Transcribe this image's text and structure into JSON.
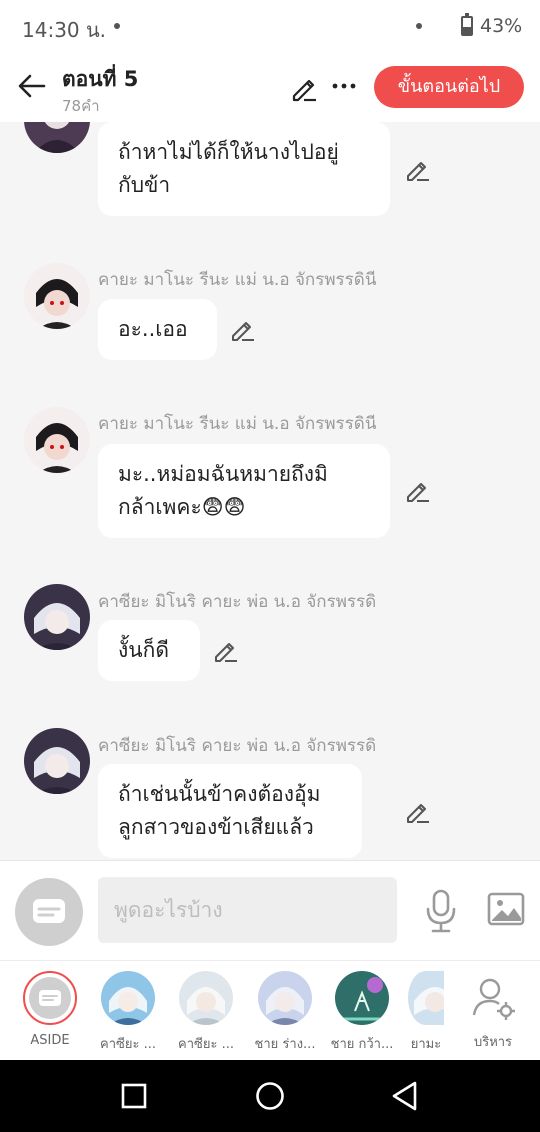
{
  "status": {
    "time": "14:30 น.",
    "battery": "43%"
  },
  "header": {
    "title": "ตอนที่ 5",
    "word_count": "78คำ",
    "next_button": "ขั้นตอนต่อไป"
  },
  "messages": [
    {
      "sender": "",
      "line1": "ถ้าหาไม่ได้ก็ให้นางไปอยู่",
      "line2": "กับข้า"
    },
    {
      "sender": "คายะ มาโนะ รีนะ แม่ น.อ จักรพรรดินี",
      "line1": "อะ..เออ",
      "line2": ""
    },
    {
      "sender": "คายะ มาโนะ รีนะ แม่ น.อ จักรพรรดินี",
      "line1": "มะ..หม่อมฉันหมายถึงมิ",
      "line2": "กล้าเพคะ😨😨"
    },
    {
      "sender": "คาซียะ มิโนริ คายะ พ่อ น.อ จักรพรรดิ",
      "line1": "งั้นก็ดี",
      "line2": ""
    },
    {
      "sender": "คาซียะ มิโนริ คายะ พ่อ น.อ จักรพรรดิ",
      "line1": "ถ้าเช่นนั้นข้าคงต้องอุ้ม",
      "line2": "ลูกสาวของข้าเสียแล้ว"
    }
  ],
  "composer": {
    "placeholder": "พูดอะไรบ้าง"
  },
  "characters": [
    {
      "label": "ASIDE"
    },
    {
      "label": "คาซียะ ..."
    },
    {
      "label": "คาซียะ ..."
    },
    {
      "label": "ชาย ร่าง..."
    },
    {
      "label": "ชาย กว้า..."
    },
    {
      "label": "ยามะ"
    },
    {
      "label": "บริหาร"
    }
  ],
  "colors": {
    "accent": "#f04d4d",
    "background": "#f5f5f5"
  }
}
